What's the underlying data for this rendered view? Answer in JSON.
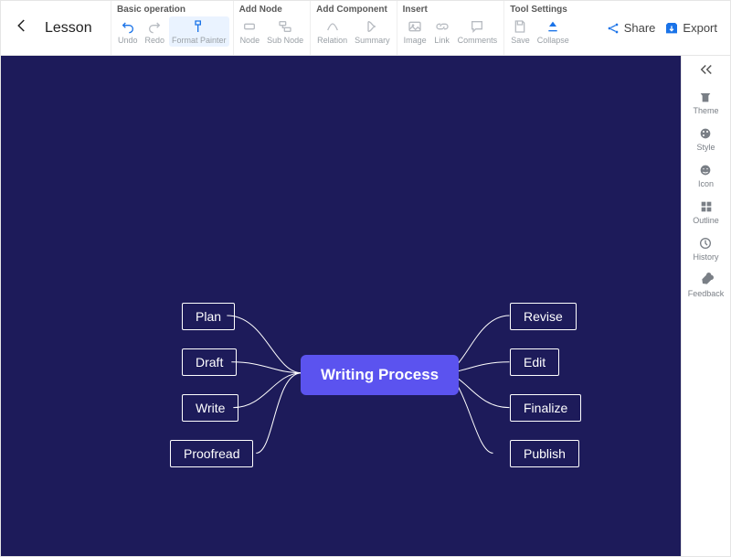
{
  "header": {
    "title": "Lesson",
    "share": "Share",
    "export": "Export"
  },
  "toolbar": {
    "groups": {
      "basic": {
        "label": "Basic operation",
        "undo": "Undo",
        "redo": "Redo",
        "format_painter": "Format Painter"
      },
      "addnode": {
        "label": "Add Node",
        "node": "Node",
        "subnode": "Sub Node"
      },
      "addcomp": {
        "label": "Add Component",
        "relation": "Relation",
        "summary": "Summary"
      },
      "insert": {
        "label": "Insert",
        "image": "Image",
        "link": "Link",
        "comments": "Comments"
      },
      "tool": {
        "label": "Tool Settings",
        "save": "Save",
        "collapse": "Collapse"
      }
    }
  },
  "sidepanel": {
    "theme": "Theme",
    "style": "Style",
    "icon": "Icon",
    "outline": "Outline",
    "history": "History",
    "feedback": "Feedback"
  },
  "mindmap": {
    "central": "Writing Process",
    "left": [
      "Plan",
      "Draft",
      "Write",
      "Proofread"
    ],
    "right": [
      "Revise",
      "Edit",
      "Finalize",
      "Publish"
    ]
  },
  "colors": {
    "canvas": "#1d1b5a",
    "central_node": "#5b53ef",
    "accent": "#1a73e8"
  }
}
